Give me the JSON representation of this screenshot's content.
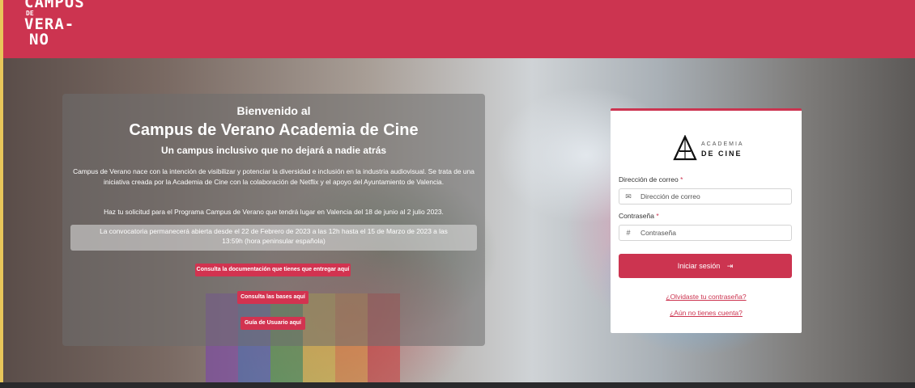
{
  "header": {
    "logo_line1": "CAMPUS",
    "logo_line2": "DE",
    "logo_line3": "VERA-",
    "logo_line4": "NO"
  },
  "welcome": {
    "greeting": "Bienvenido al",
    "title": "Campus de Verano Academia de Cine",
    "subtitle": "Un campus inclusivo que no dejará a nadie atrás",
    "description": "Campus de Verano nace con la intención de visibilizar y potenciar la diversidad e inclusión en la industria audiovisual. Se trata de una iniciativa creada por la Academia de Cine con la colaboración de Netflix y el apoyo del Ayuntamiento de Valencia.",
    "dates": "Haz tu solicitud para el Programa Campus de Verano que tendrá lugar en Valencia del 18 de junio al 2 julio 2023.",
    "window": "La convocatoria permanecerá abierta desde el 22 de Febrero de 2023 a las 12h hasta el 15 de Marzo de 2023 a las 13:59h (hora peninsular española)",
    "buttons": {
      "docs": "Consulta la documentación que tienes que entregar aquí",
      "bases": "Consulta las bases aquí",
      "guide": "Guía de Usuario aquí"
    }
  },
  "login": {
    "brand_top": "ACADEMIA",
    "brand_bottom": "DE CINE",
    "email_label": "Dirección de correo",
    "email_placeholder": "Dirección de correo",
    "password_label": "Contraseña",
    "password_placeholder": "Contraseña",
    "required_mark": "*",
    "submit_label": "Iniciar sesión",
    "forgot_link": "¿Olvidaste tu contraseña?",
    "register_link": "¿Aún no tienes cuenta?",
    "icons": {
      "email": "envelope-icon",
      "password": "hash-icon",
      "submit": "sign-in-icon"
    }
  },
  "colors": {
    "brand_red": "#cc3450",
    "button_red": "#d23350",
    "accent_yellow": "#e8c65a"
  }
}
